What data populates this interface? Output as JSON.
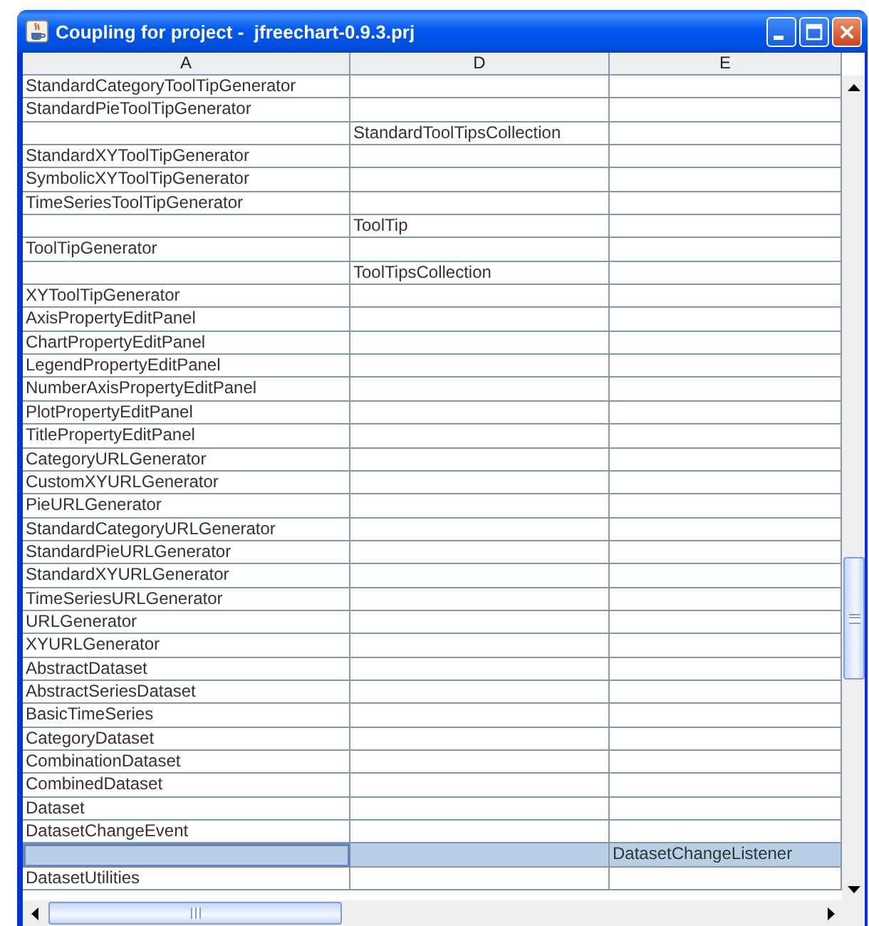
{
  "window": {
    "title": "Coupling for project -  jfreechart-0.9.3.prj"
  },
  "table": {
    "columns": [
      "A",
      "D",
      "E"
    ],
    "rows": [
      {
        "a": "StandardCategoryToolTipGenerator",
        "selected": false
      },
      {
        "a": "StandardPieToolTipGenerator",
        "selected": false
      },
      {
        "d": "StandardToolTipsCollection",
        "selected": false
      },
      {
        "a": "StandardXYToolTipGenerator",
        "selected": false
      },
      {
        "a": "SymbolicXYToolTipGenerator",
        "selected": false
      },
      {
        "a": "TimeSeriesToolTipGenerator",
        "selected": false
      },
      {
        "d": "ToolTip",
        "selected": false
      },
      {
        "a": "ToolTipGenerator",
        "selected": false
      },
      {
        "d": "ToolTipsCollection",
        "selected": false
      },
      {
        "a": "XYToolTipGenerator",
        "selected": false
      },
      {
        "a": "AxisPropertyEditPanel",
        "selected": false
      },
      {
        "a": "ChartPropertyEditPanel",
        "selected": false
      },
      {
        "a": "LegendPropertyEditPanel",
        "selected": false
      },
      {
        "a": "NumberAxisPropertyEditPanel",
        "selected": false
      },
      {
        "a": "PlotPropertyEditPanel",
        "selected": false
      },
      {
        "a": "TitlePropertyEditPanel",
        "selected": false
      },
      {
        "a": "CategoryURLGenerator",
        "selected": false
      },
      {
        "a": "CustomXYURLGenerator",
        "selected": false
      },
      {
        "a": "PieURLGenerator",
        "selected": false
      },
      {
        "a": "StandardCategoryURLGenerator",
        "selected": false
      },
      {
        "a": "StandardPieURLGenerator",
        "selected": false
      },
      {
        "a": "StandardXYURLGenerator",
        "selected": false
      },
      {
        "a": "TimeSeriesURLGenerator",
        "selected": false
      },
      {
        "a": "URLGenerator",
        "selected": false
      },
      {
        "a": "XYURLGenerator",
        "selected": false
      },
      {
        "a": "AbstractDataset",
        "selected": false
      },
      {
        "a": "AbstractSeriesDataset",
        "selected": false
      },
      {
        "a": "BasicTimeSeries",
        "selected": false
      },
      {
        "a": "CategoryDataset",
        "selected": false
      },
      {
        "a": "CombinationDataset",
        "selected": false
      },
      {
        "a": "CombinedDataset",
        "selected": false
      },
      {
        "a": "Dataset",
        "selected": false
      },
      {
        "a": "DatasetChangeEvent",
        "selected": false
      },
      {
        "e": "DatasetChangeListener",
        "selected": true
      },
      {
        "a": "DatasetUtilities",
        "selected": false
      }
    ]
  }
}
